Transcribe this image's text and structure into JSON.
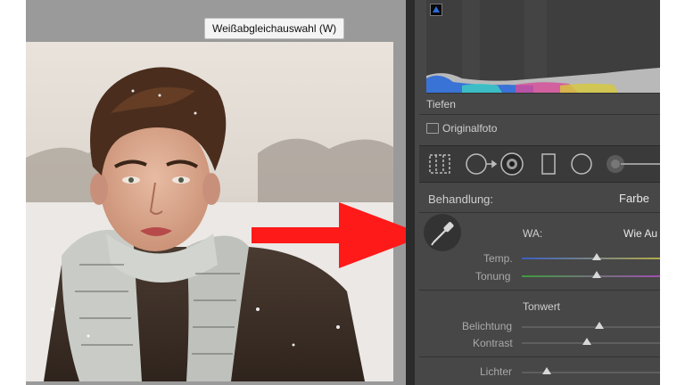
{
  "tooltip": {
    "text": "Weißabgleichauswahl (W)"
  },
  "histogram": {
    "label": "Tiefen"
  },
  "original": {
    "label": "Originalfoto"
  },
  "tools": [
    "crop-overlay-icon",
    "spot-removal-icon",
    "red-eye-icon",
    "graduated-filter-icon",
    "radial-filter-icon",
    "adjustment-brush-icon"
  ],
  "treatment": {
    "label": "Behandlung:",
    "value": "Farbe"
  },
  "white_balance": {
    "label": "WA:",
    "preset": "Wie Au",
    "temp_label": "Temp.",
    "tint_label": "Tonung",
    "temp_value": 0.54,
    "tint_value": 0.54
  },
  "tone": {
    "section_label": "Tonwert",
    "exposure_label": "Belichtung",
    "contrast_label": "Kontrast",
    "highlights_label": "Lichter",
    "exposure_value": 0.56,
    "contrast_value": 0.47,
    "highlights_value": 0.18
  },
  "colors": {
    "panel_bg": "#474747",
    "arrow": "#ff1a1a",
    "hist_blue": "#2c6bd9"
  }
}
